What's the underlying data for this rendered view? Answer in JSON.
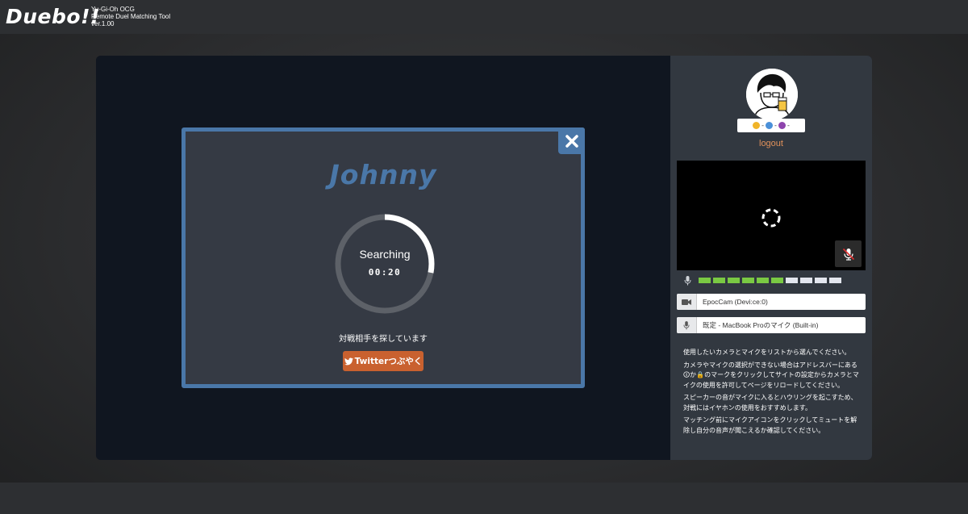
{
  "app": {
    "logo": "Duebo!!",
    "subtitle_lines": [
      "Yu-Gi-Oh OCG",
      "Remote Duel Matching Tool",
      "ver.1.00"
    ]
  },
  "modal": {
    "opponent_name": "Johnny",
    "status": "Searching",
    "timer": "00:20",
    "progress": 0.28,
    "message": "対戦相手を探しています",
    "twitter_button": "Twitterつぶやく"
  },
  "sidebar": {
    "ratings": [
      {
        "icon": "smile-face-icon",
        "color": "#f0b429",
        "value": "-"
      },
      {
        "icon": "neutral-face-icon",
        "color": "#4a90d9",
        "value": "-"
      },
      {
        "icon": "frown-face-icon",
        "color": "#8e44ad",
        "value": "-"
      }
    ],
    "logout": "logout",
    "mic_level": {
      "active": 6,
      "total": 10,
      "on_color": "#7ac943",
      "off_color": "#e3e6ee"
    },
    "camera_device": "EpocCam (Devi:ce:0)",
    "mic_device": "既定 - MacBook Proのマイク (Built-in)",
    "instructions": [
      "使用したいカメラとマイクをリストから選んでください。",
      "カメラやマイクの選択ができない場合はアドレスバーにある🛈か🔒のマークをクリックしてサイトの設定からカメラとマイクの使用を許可してページをリロードしてください。",
      "スピーカーの音がマイクに入るとハウリングを起こすため、対戦にはイヤホンの使用をおすすめします。",
      "マッチング前にマイクアイコンをクリックしてミュートを解除し自分の音声が聞こえるか確認してください。"
    ]
  },
  "colors": {
    "accent_blue": "#4a77a8",
    "logout_orange": "#e0915b",
    "twitter_button": "#c9612f"
  }
}
